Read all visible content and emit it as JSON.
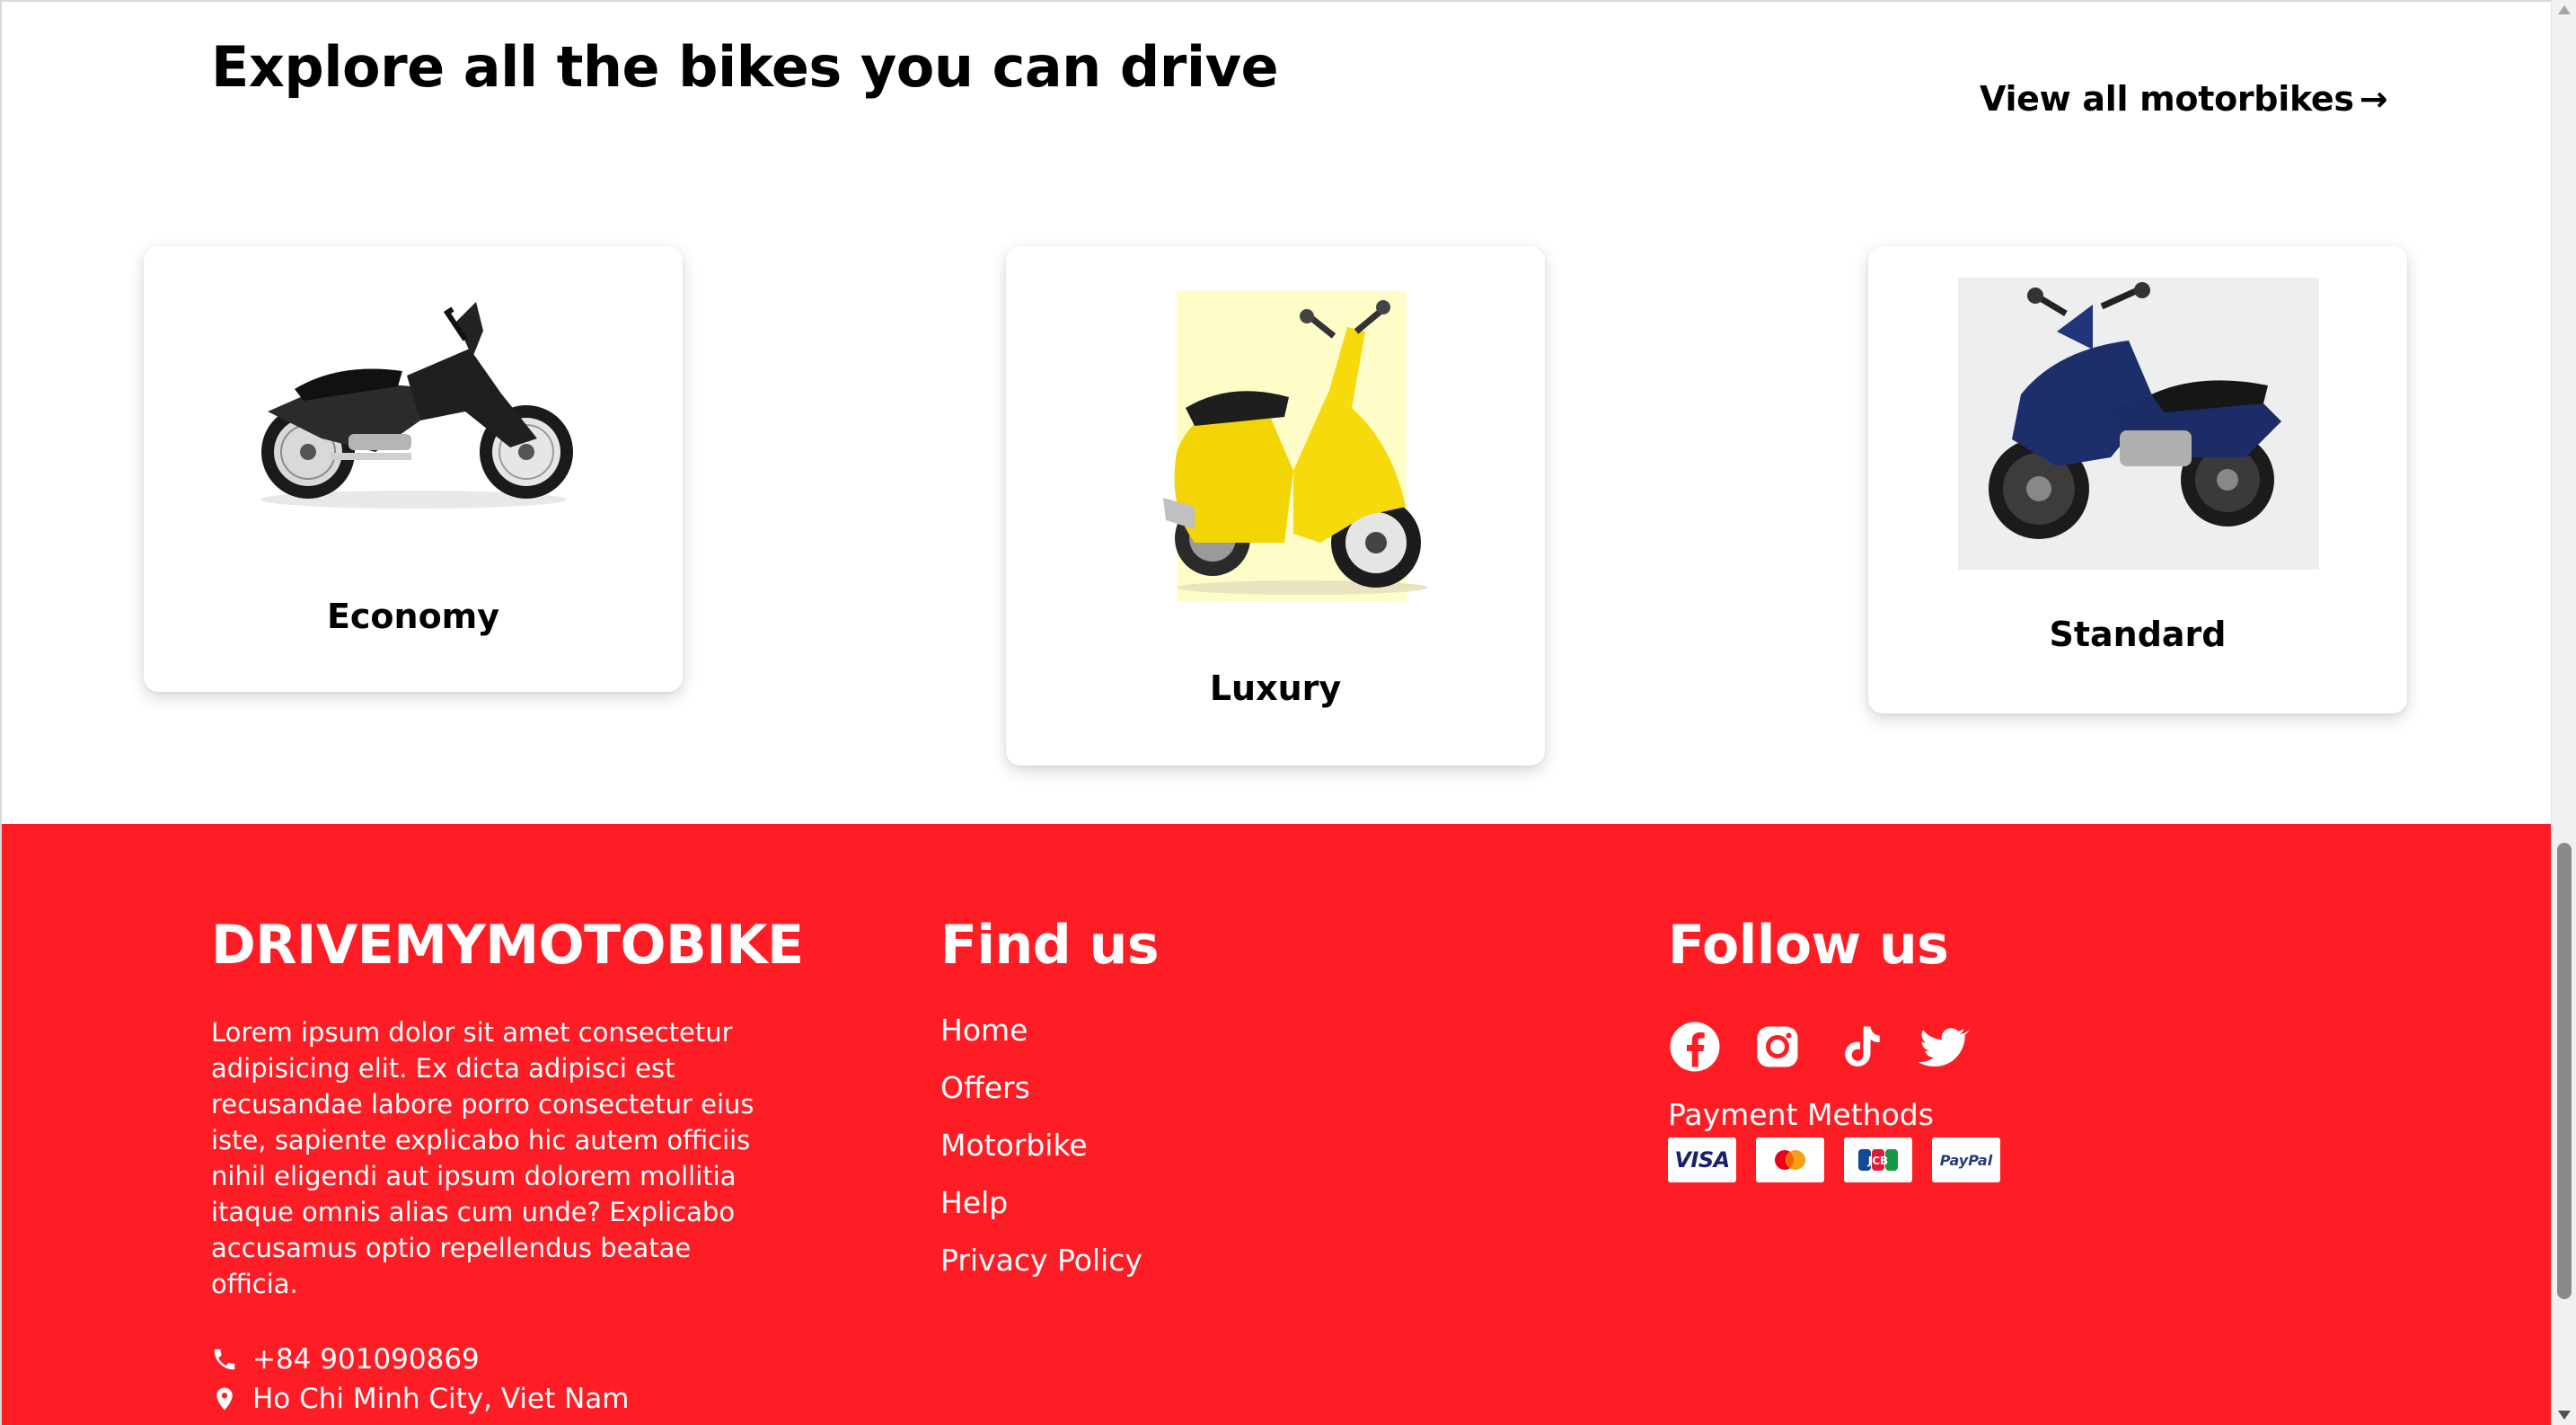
{
  "explore": {
    "title": "Explore all the bikes you can drive",
    "view_all_label": "View all motorbikes",
    "view_all_arrow": "→",
    "cards": [
      {
        "label": "Economy",
        "image": "black-underbone-motorbike"
      },
      {
        "label": "Luxury",
        "image": "yellow-vespa-scooter"
      },
      {
        "label": "Standard",
        "image": "blue-underbone-motorbike"
      }
    ]
  },
  "footer": {
    "brand": "DRIVEMYMOTOBIKE",
    "description": "Lorem ipsum dolor sit amet consectetur adipisicing elit. Ex dicta adipisci est recusandae labore porro consectetur eius iste, sapiente explicabo hic autem officiis nihil eligendi aut ipsum dolorem mollitia itaque omnis alias cum unde? Explicabo accusamus optio repellendus beatae officia.",
    "phone": "+84 901090869",
    "address": "Ho Chi Minh City, Viet Nam",
    "find_us_title": "Find us",
    "find_us_links": [
      "Home",
      "Offers",
      "Motorbike",
      "Help",
      "Privacy Policy"
    ],
    "follow_us_title": "Follow us",
    "socials": [
      "facebook-icon",
      "instagram-icon",
      "tiktok-icon",
      "twitter-icon"
    ],
    "payment_label": "Payment Methods",
    "payment_methods": [
      "VISA",
      "Mastercard",
      "JCB",
      "PayPal"
    ],
    "payment_texts": {
      "visa": "VISA",
      "jcb": "JCB",
      "paypal": "PayPal"
    }
  },
  "colors": {
    "footer_bg": "#fe1d25",
    "text_dark": "#000000",
    "text_light": "#ffffff"
  }
}
